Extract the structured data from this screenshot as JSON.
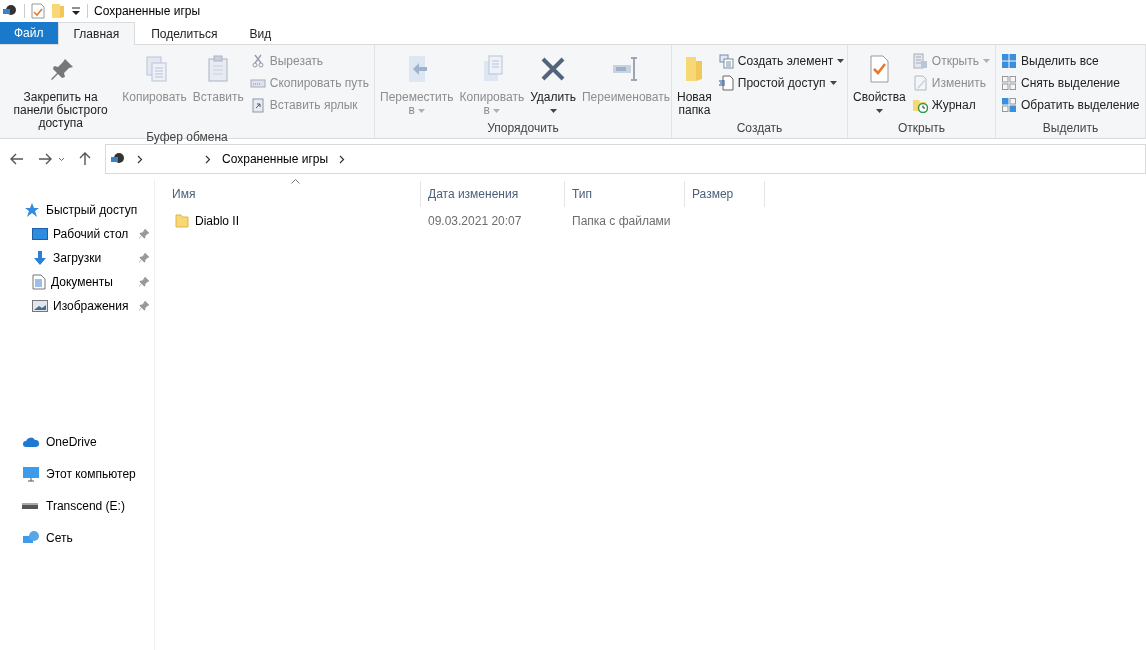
{
  "window": {
    "title": "Сохраненные игры"
  },
  "ribbon_tabs": [
    {
      "label": "Файл",
      "kind": "file",
      "selected": false
    },
    {
      "label": "Главная",
      "kind": "tab",
      "selected": true
    },
    {
      "label": "Поделиться",
      "kind": "tab",
      "selected": false
    },
    {
      "label": "Вид",
      "kind": "tab",
      "selected": false
    }
  ],
  "ribbon_groups": [
    {
      "label": "Буфер обмена",
      "items": [
        {
          "kind": "large",
          "label": "Закрепить на панели быстрого доступа",
          "disabled": false,
          "dropdown": false
        },
        {
          "kind": "large",
          "label": "Копировать",
          "disabled": true,
          "dropdown": false
        },
        {
          "kind": "large",
          "label": "Вставить",
          "disabled": true,
          "dropdown": false
        },
        {
          "kind": "small",
          "label": "Вырезать",
          "disabled": true,
          "dropdown": false
        },
        {
          "kind": "small",
          "label": "Скопировать путь",
          "disabled": true,
          "dropdown": false
        },
        {
          "kind": "small",
          "label": "Вставить ярлык",
          "disabled": true,
          "dropdown": false
        }
      ]
    },
    {
      "label": "Упорядочить",
      "items": [
        {
          "kind": "large",
          "label": "Переместить в",
          "disabled": true,
          "dropdown": true
        },
        {
          "kind": "large",
          "label": "Копировать в",
          "disabled": true,
          "dropdown": true
        },
        {
          "kind": "large",
          "label": "Удалить",
          "disabled": false,
          "dropdown": true
        },
        {
          "kind": "large",
          "label": "Переименовать",
          "disabled": true,
          "dropdown": false
        }
      ]
    },
    {
      "label": "Создать",
      "items": [
        {
          "kind": "large",
          "label": "Новая папка",
          "disabled": false,
          "dropdown": false
        },
        {
          "kind": "small",
          "label": "Создать элемент",
          "disabled": false,
          "dropdown": true
        },
        {
          "kind": "small",
          "label": "Простой доступ",
          "disabled": false,
          "dropdown": true
        }
      ]
    },
    {
      "label": "Открыть",
      "items": [
        {
          "kind": "large",
          "label": "Свойства",
          "disabled": false,
          "dropdown": true
        },
        {
          "kind": "small",
          "label": "Открыть",
          "disabled": true,
          "dropdown": true
        },
        {
          "kind": "small",
          "label": "Изменить",
          "disabled": true,
          "dropdown": false
        },
        {
          "kind": "small",
          "label": "Журнал",
          "disabled": false,
          "dropdown": false
        }
      ]
    },
    {
      "label": "Выделить",
      "items": [
        {
          "kind": "small",
          "label": "Выделить все",
          "disabled": false,
          "dropdown": false
        },
        {
          "kind": "small",
          "label": "Снять выделение",
          "disabled": false,
          "dropdown": false
        },
        {
          "kind": "small",
          "label": "Обратить выделение",
          "disabled": false,
          "dropdown": false
        }
      ]
    }
  ],
  "address_bar": {
    "path": [
      "Сохраненные игры"
    ]
  },
  "navigation": [
    {
      "label": "Быстрый доступ",
      "children": [
        {
          "label": "Рабочий стол",
          "pinned": true
        },
        {
          "label": "Загрузки",
          "pinned": true
        },
        {
          "label": "Документы",
          "pinned": true
        },
        {
          "label": "Изображения",
          "pinned": true
        }
      ]
    },
    {
      "label": "OneDrive"
    },
    {
      "label": "Этот компьютер"
    },
    {
      "label": "Transcend (E:)"
    },
    {
      "label": "Сеть"
    }
  ],
  "file_list": {
    "columns": [
      {
        "label": "Имя",
        "sorted": true
      },
      {
        "label": "Дата изменения",
        "sorted": false
      },
      {
        "label": "Тип",
        "sorted": false
      },
      {
        "label": "Размер",
        "sorted": false
      }
    ],
    "rows": [
      {
        "name": "Diablo II",
        "date": "09.03.2021 20:07",
        "type": "Папка с файлами"
      }
    ]
  }
}
